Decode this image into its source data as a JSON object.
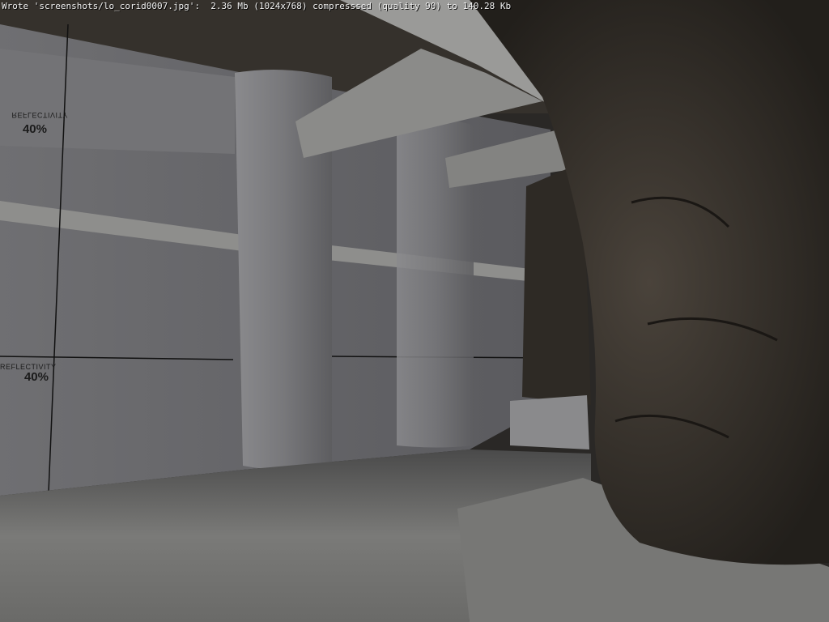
{
  "console": {
    "message": "Wrote 'screenshots/lo_corid0007.jpg':  2.36 Mb (1024x768) compresssed (quality 90) to 140.28 Kb"
  },
  "wall_labels": [
    {
      "title": "REFLECTIVITY",
      "value": "40%"
    },
    {
      "title": "REFLECTIVITY",
      "value": "40%"
    }
  ],
  "colors": {
    "wall": "#7d7d80",
    "rock": "#3a3530",
    "floor": "#6c6c6a"
  }
}
